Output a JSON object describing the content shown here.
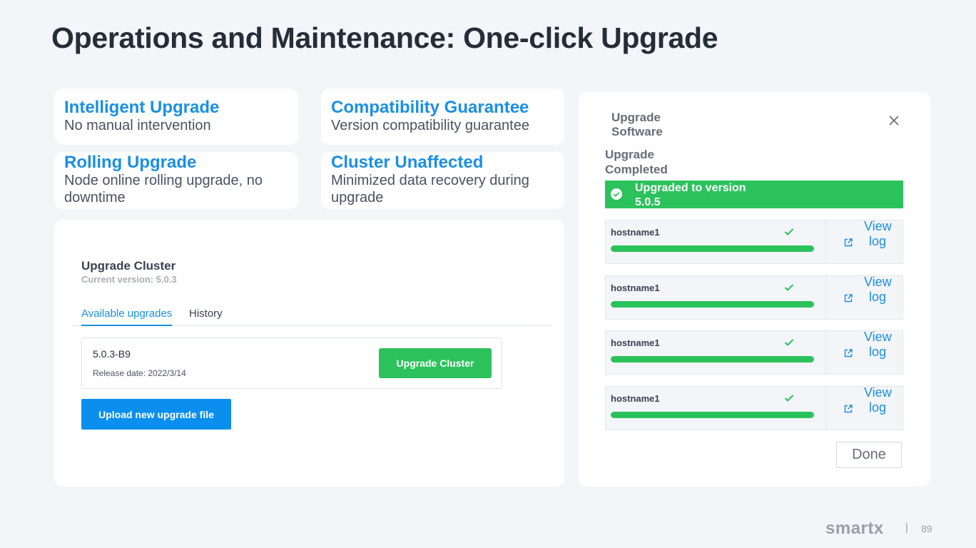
{
  "title": "Operations and Maintenance: One-click Upgrade",
  "features": [
    {
      "title": "Intelligent Upgrade",
      "desc": "No manual intervention"
    },
    {
      "title": "Compatibility Guarantee",
      "desc": "Version compatibility guarantee"
    },
    {
      "title": "Rolling Upgrade",
      "desc": "Node online rolling upgrade, no downtime"
    },
    {
      "title": "Cluster Unaffected",
      "desc": "Minimized data recovery during upgrade"
    }
  ],
  "upgrade_cluster": {
    "title": "Upgrade Cluster",
    "current_version": "Current version: 5.0.3",
    "tabs": [
      {
        "label": "Available upgrades",
        "active": true
      },
      {
        "label": "History",
        "active": false
      }
    ],
    "item": {
      "version": "5.0.3-B9",
      "release_date": "Release date: 2022/3/14",
      "button_label": "Upgrade Cluster"
    },
    "upload_label": "Upload new upgrade file"
  },
  "upgrade_dialog": {
    "title": "Upgrade Software",
    "status_label": "Upgrade Completed",
    "success_message": "Upgraded to version 5.0.5",
    "hosts": [
      {
        "name": "hostname1",
        "progress": 1.0,
        "link": "View log"
      },
      {
        "name": "hostname1",
        "progress": 1.0,
        "link": "View log"
      },
      {
        "name": "hostname1",
        "progress": 1.0,
        "link": "View log"
      },
      {
        "name": "hostname1",
        "progress": 1.0,
        "link": "View log"
      }
    ],
    "done_label": "Done"
  },
  "footer": {
    "logo": "smartx",
    "separator": "|",
    "page": "89"
  },
  "colors": {
    "accent_blue": "#1a8fe3",
    "success_green": "#2bc25c",
    "background": "#f3f5f9"
  }
}
